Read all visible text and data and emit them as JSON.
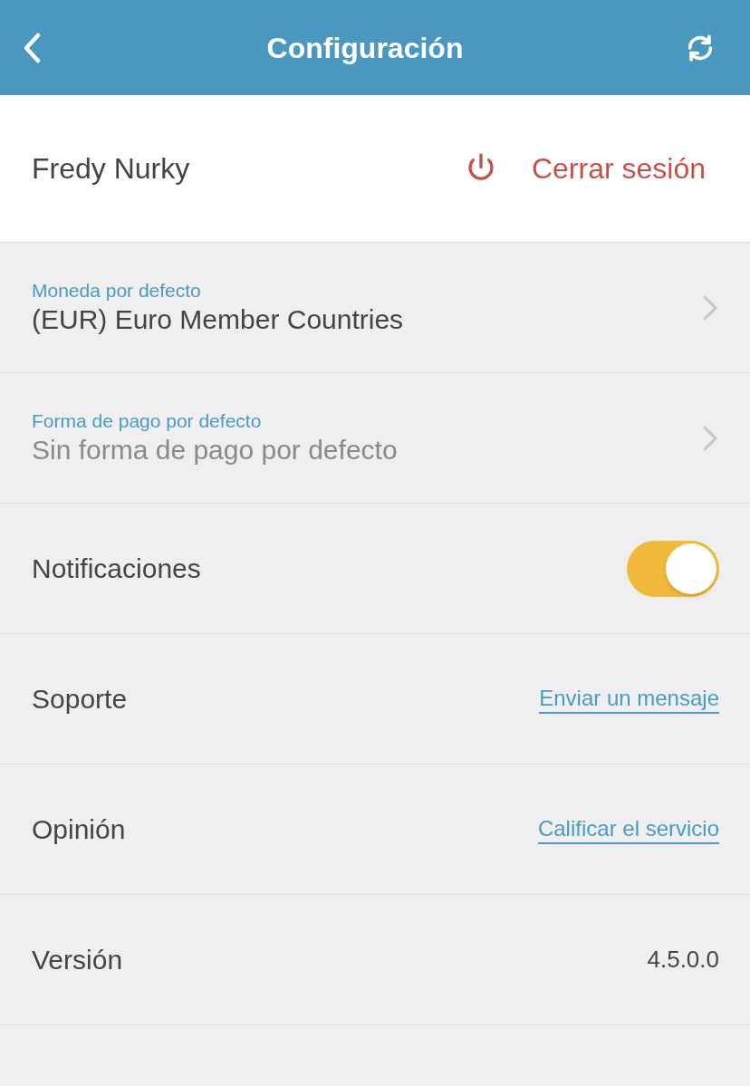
{
  "header": {
    "title": "Configuración"
  },
  "account": {
    "name": "Fredy Nurky",
    "logout": "Cerrar sesión"
  },
  "settings": [
    {
      "kind": "picker",
      "label": "Moneda por defecto",
      "value": "(EUR) Euro Member Countries",
      "empty": false
    },
    {
      "kind": "picker",
      "label": "Forma de pago por defecto",
      "value": "Sin forma de pago por defecto",
      "empty": true
    },
    {
      "kind": "toggle",
      "label": "Notificaciones",
      "on": true
    },
    {
      "kind": "link",
      "label": "Soporte",
      "link": "Enviar un mensaje"
    },
    {
      "kind": "link",
      "label": "Opinión",
      "link": "Calificar el servicio"
    },
    {
      "kind": "info",
      "label": "Versión",
      "value": "4.5.0.0"
    }
  ]
}
